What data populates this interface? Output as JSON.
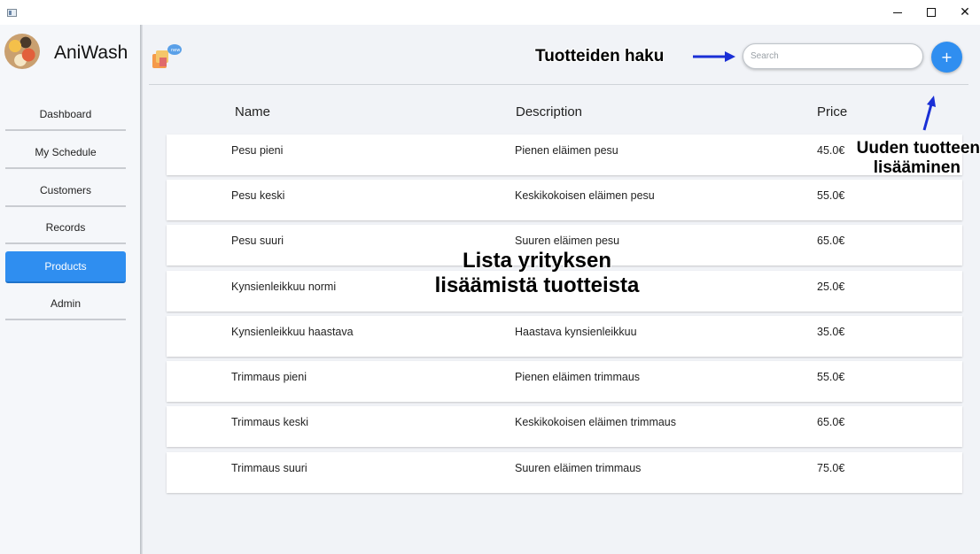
{
  "brand": {
    "name": "AniWash"
  },
  "sidebar": {
    "items": [
      {
        "label": "Dashboard",
        "active": false
      },
      {
        "label": "My Schedule",
        "active": false
      },
      {
        "label": "Customers",
        "active": false
      },
      {
        "label": "Records",
        "active": false
      },
      {
        "label": "Products",
        "active": true
      },
      {
        "label": "Admin",
        "active": false
      }
    ]
  },
  "search": {
    "placeholder": "Search",
    "value": ""
  },
  "add_button": {
    "label": "+"
  },
  "table": {
    "columns": [
      "Name",
      "Description",
      "Price"
    ],
    "rows": [
      {
        "name": "Pesu pieni",
        "description": "Pienen eläimen pesu",
        "price": "45.0€"
      },
      {
        "name": "Pesu keski",
        "description": "Keskikokoisen eläimen pesu",
        "price": "55.0€"
      },
      {
        "name": "Pesu suuri",
        "description": "Suuren eläimen pesu",
        "price": "65.0€"
      },
      {
        "name": "Kynsienleikkuu normi",
        "description": "",
        "price": "25.0€"
      },
      {
        "name": "Kynsienleikkuu haastava",
        "description": "Haastava kynsienleikkuu",
        "price": "35.0€"
      },
      {
        "name": "Trimmaus pieni",
        "description": "Pienen eläimen trimmaus",
        "price": "55.0€"
      },
      {
        "name": "Trimmaus keski",
        "description": "Keskikokoisen eläimen trimmaus",
        "price": "65.0€"
      },
      {
        "name": "Trimmaus suuri",
        "description": "Suuren eläimen trimmaus",
        "price": "75.0€"
      }
    ]
  },
  "annotations": {
    "search_hint": "Tuotteiden haku",
    "add_hint_line1": "Uuden tuotteen",
    "add_hint_line2": "lisääminen",
    "list_hint_line1": "Lista yrityksen",
    "list_hint_line2": "lisäämistä tuotteista"
  },
  "colors": {
    "accent": "#2f8ef0",
    "sidebar_bg": "#f5f7fa",
    "main_bg": "#f1f3f7",
    "annotation_arrow": "#1a2fd6"
  },
  "icons": {
    "window_min": "minimize-icon",
    "window_max": "maximize-icon",
    "window_close": "close-icon",
    "header": "products-header-icon"
  }
}
